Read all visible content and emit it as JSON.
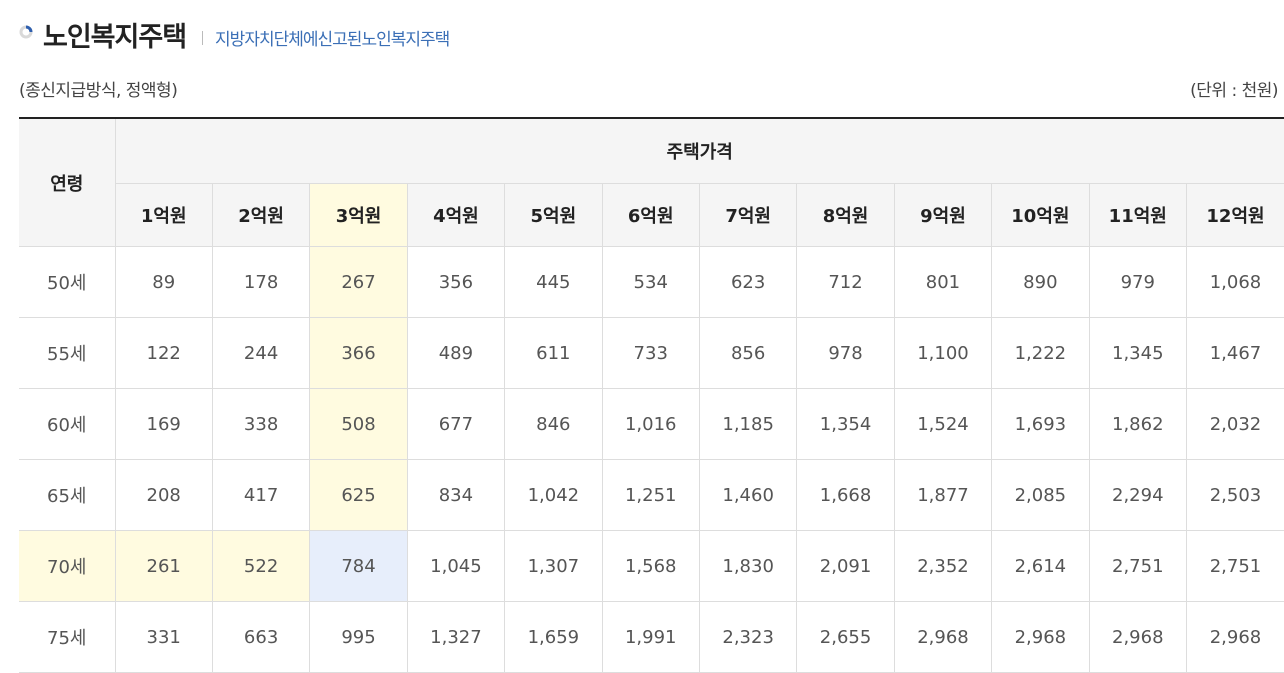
{
  "header": {
    "title": "노인복지주택",
    "subtitle": "지방자치단체에신고된노인복지주택",
    "icon": "ring-icon"
  },
  "meta": {
    "left": "(종신지급방식, 정액형)",
    "right": "(단위 : 천원)"
  },
  "colors": {
    "highlight_yellow": "#fffbe0",
    "highlight_blue": "#e7eefb",
    "subtitle_blue": "#3b6fb6"
  },
  "table": {
    "age_header": "연령",
    "group_header": "주택가격",
    "columns": [
      "1억원",
      "2억원",
      "3억원",
      "4억원",
      "5억원",
      "6억원",
      "7억원",
      "8억원",
      "9억원",
      "10억원",
      "11억원",
      "12억원"
    ],
    "rows": [
      {
        "age": "50세",
        "values": [
          "89",
          "178",
          "267",
          "356",
          "445",
          "534",
          "623",
          "712",
          "801",
          "890",
          "979",
          "1,068"
        ]
      },
      {
        "age": "55세",
        "values": [
          "122",
          "244",
          "366",
          "489",
          "611",
          "733",
          "856",
          "978",
          "1,100",
          "1,222",
          "1,345",
          "1,467"
        ]
      },
      {
        "age": "60세",
        "values": [
          "169",
          "338",
          "508",
          "677",
          "846",
          "1,016",
          "1,185",
          "1,354",
          "1,524",
          "1,693",
          "1,862",
          "2,032"
        ]
      },
      {
        "age": "65세",
        "values": [
          "208",
          "417",
          "625",
          "834",
          "1,042",
          "1,251",
          "1,460",
          "1,668",
          "1,877",
          "2,085",
          "2,294",
          "2,503"
        ]
      },
      {
        "age": "70세",
        "values": [
          "261",
          "522",
          "784",
          "1,045",
          "1,307",
          "1,568",
          "1,830",
          "2,091",
          "2,352",
          "2,614",
          "2,751",
          "2,751"
        ]
      },
      {
        "age": "75세",
        "values": [
          "331",
          "663",
          "995",
          "1,327",
          "1,659",
          "1,991",
          "2,323",
          "2,655",
          "2,968",
          "2,968",
          "2,968",
          "2,968"
        ]
      }
    ]
  }
}
